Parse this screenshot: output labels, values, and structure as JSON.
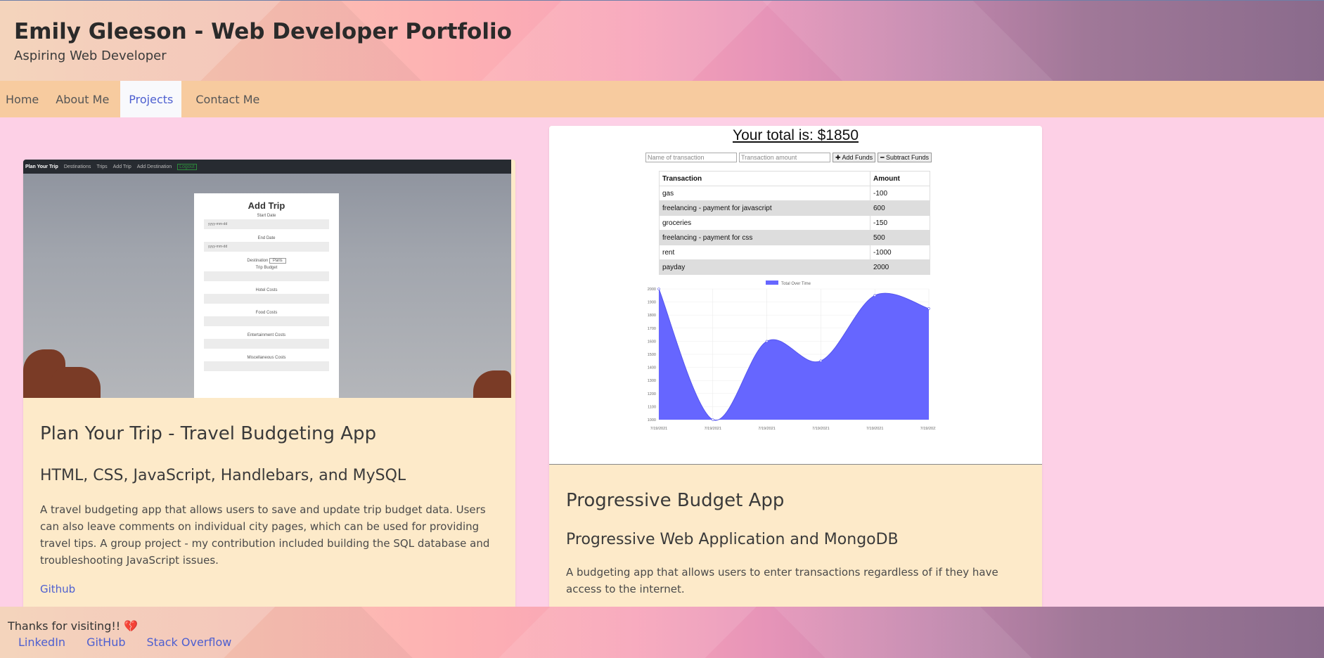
{
  "header": {
    "title": "Emily Gleeson - Web Developer Portfolio",
    "subtitle": "Aspiring Web Developer"
  },
  "nav": {
    "items": [
      "Home",
      "About Me",
      "Projects",
      "Contact Me"
    ],
    "active": "Projects"
  },
  "projects": [
    {
      "screenshot": {
        "nav_brand": "Plan Your Trip",
        "nav_links": [
          "Destinations",
          "Trips",
          "Add Trip",
          "Add Destination"
        ],
        "nav_logout": "Logout",
        "form_title": "Add Trip",
        "fields": [
          "Start Date",
          "End Date",
          "Destination",
          "Trip Budget",
          "Hotel Costs",
          "Food Costs",
          "Entertainment Costs",
          "Miscellaneous Costs"
        ],
        "date_placeholder": "yyyy-mm-dd",
        "destination_value": "Paris"
      },
      "title": "Plan Your Trip - Travel Budgeting App",
      "tech": "HTML, CSS, JavaScript, Handlebars, and MySQL",
      "description": "A travel budgeting app that allows users to save and update trip budget data. Users can also leave comments on individual city pages, which can be used for providing travel tips. A group project - my contribution included building the SQL database and troubleshooting JavaScript issues.",
      "link": "Github"
    },
    {
      "screenshot": {
        "total": "Your total is: $1850",
        "name_placeholder": "Name of transaction",
        "amount_placeholder": "Transaction amount",
        "add_label": "✚ Add Funds",
        "subtract_label": "━ Subtract Funds",
        "table_headers": [
          "Transaction",
          "Amount"
        ],
        "rows": [
          [
            "gas",
            "-100"
          ],
          [
            "freelancing - payment for javascript",
            "600"
          ],
          [
            "groceries",
            "-150"
          ],
          [
            "freelancing - payment for css",
            "500"
          ],
          [
            "rent",
            "-1000"
          ],
          [
            "payday",
            "2000"
          ]
        ],
        "chart_legend": "Total Over Time"
      },
      "title": "Progressive Budget App",
      "tech": "Progressive Web Application and MongoDB",
      "description": "A budgeting app that allows users to enter transactions regardless of if they have access to the internet."
    }
  ],
  "chart_data": {
    "type": "area",
    "title": "",
    "legend": [
      "Total Over Time"
    ],
    "x": [
      "7/19/2021",
      "7/19/2021",
      "7/19/2021",
      "7/19/2021",
      "7/19/2021",
      "7/19/2021"
    ],
    "y_ticks": [
      1000,
      1100,
      1200,
      1300,
      1400,
      1500,
      1600,
      1700,
      1800,
      1900,
      2000
    ],
    "series": [
      {
        "name": "Total Over Time",
        "values": [
          2000,
          1000,
          1600,
          1450,
          1950,
          1850
        ]
      }
    ],
    "ylim": [
      1000,
      2000
    ],
    "color": "#6666ff"
  },
  "footer": {
    "message": "Thanks for visiting!! ",
    "heart": "💔",
    "links": [
      "LinkedIn",
      "GitHub",
      "Stack Overflow"
    ]
  }
}
